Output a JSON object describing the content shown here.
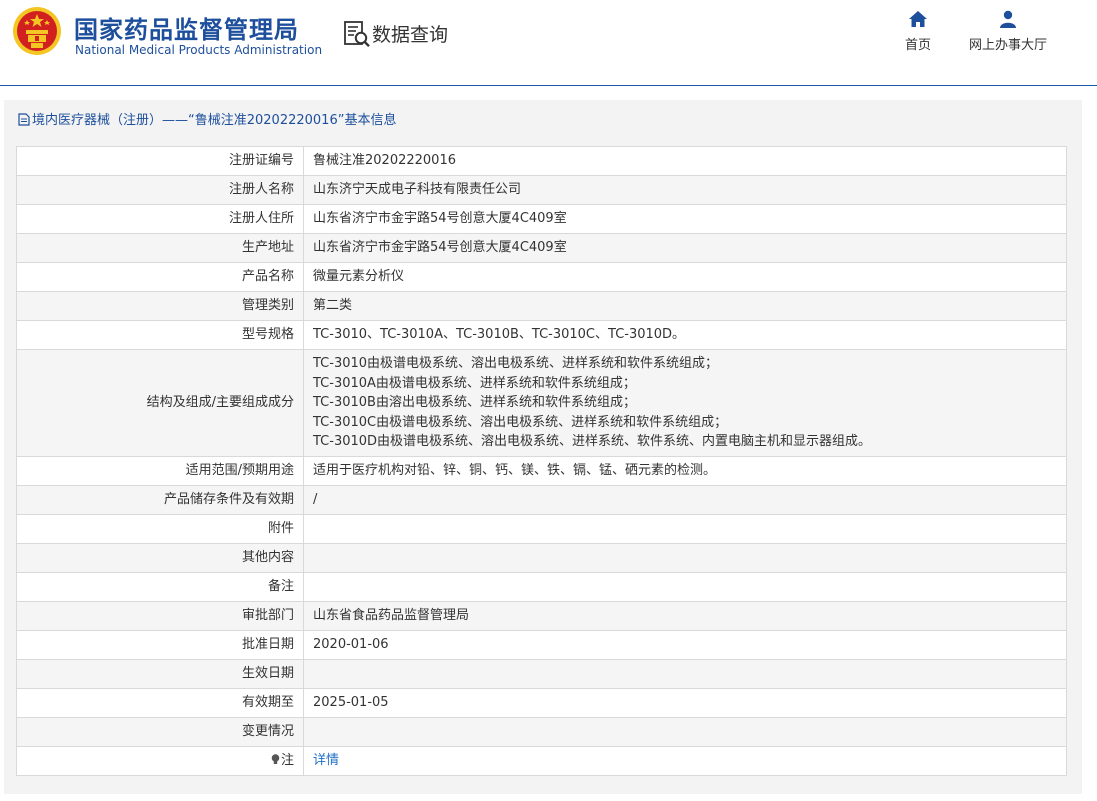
{
  "header": {
    "org_name_cn": "国家药品监督管理局",
    "org_name_en": "National Medical Products Administration",
    "section_title": "数据查询",
    "nav": [
      {
        "label": "首页",
        "icon": "home-icon"
      },
      {
        "label": "网上办事大厅",
        "icon": "user-icon"
      }
    ]
  },
  "panel": {
    "title": "境内医疗器械（注册）——“鲁械注准20202220016”基本信息"
  },
  "rows": [
    {
      "label": "注册证编号",
      "value": "鲁械注准20202220016"
    },
    {
      "label": "注册人名称",
      "value": "山东济宁天成电子科技有限责任公司"
    },
    {
      "label": "注册人住所",
      "value": "山东省济宁市金宇路54号创意大厦4C409室"
    },
    {
      "label": "生产地址",
      "value": "山东省济宁市金宇路54号创意大厦4C409室"
    },
    {
      "label": "产品名称",
      "value": "微量元素分析仪"
    },
    {
      "label": "管理类别",
      "value": "第二类"
    },
    {
      "label": "型号规格",
      "value": "TC-3010、TC-3010A、TC-3010B、TC-3010C、TC-3010D。"
    },
    {
      "label": "结构及组成/主要组成成分",
      "lines": [
        "TC-3010由极谱电极系统、溶出电极系统、进样系统和软件系统组成；",
        "TC-3010A由极谱电极系统、进样系统和软件系统组成；",
        "TC-3010B由溶出电极系统、进样系统和软件系统组成；",
        "TC-3010C由极谱电极系统、溶出电极系统、进样系统和软件系统组成；",
        "TC-3010D由极谱电极系统、溶出电极系统、进样系统、软件系统、内置电脑主机和显示器组成。"
      ]
    },
    {
      "label": "适用范围/预期用途",
      "value": "适用于医疗机构对铅、锌、铜、钙、镁、铁、镉、锰、硒元素的检测。"
    },
    {
      "label": "产品储存条件及有效期",
      "value": "/"
    },
    {
      "label": "附件",
      "value": ""
    },
    {
      "label": "其他内容",
      "value": ""
    },
    {
      "label": "备注",
      "value": ""
    },
    {
      "label": "审批部门",
      "value": "山东省食品药品监督管理局"
    },
    {
      "label": "批准日期",
      "value": "2020-01-06"
    },
    {
      "label": "生效日期",
      "value": ""
    },
    {
      "label": "有效期至",
      "value": "2025-01-05"
    },
    {
      "label": "变更情况",
      "value": ""
    }
  ],
  "note_row": {
    "label": "注",
    "link": "详情",
    "icon": "bulb-icon"
  },
  "colors": {
    "brand_blue": "#1d4f9c",
    "link_blue": "#1d6fc8",
    "emblem_red": "#d21f1f",
    "emblem_gold": "#f3c623"
  }
}
